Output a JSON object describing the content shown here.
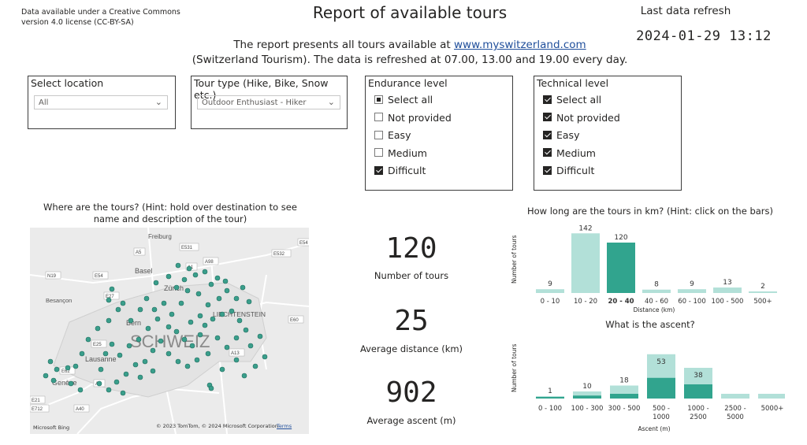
{
  "header": {
    "license": "Data available under a Creative Commons version 4.0 license (CC-BY-SA)",
    "title": "Report of available tours",
    "refresh_label": "Last data refresh",
    "refresh_value": "2024-01-29 13:12",
    "desc_pre": "The report presents all tours available at ",
    "desc_link": "www.myswitzerland.com",
    "desc_post": "(Switzerland Tourism). The data is refreshed at 07.00, 13.00 and 19.00 every day."
  },
  "filters": {
    "location": {
      "title": "Select location",
      "value": "All"
    },
    "tour_type": {
      "title": "Tour type (Hike, Bike, Snow etc.)",
      "value": "Outdoor Enthusiast - Hiker"
    },
    "endurance": {
      "title": "Endurance level",
      "items": [
        {
          "label": "Select all",
          "state": "partial"
        },
        {
          "label": "Not provided",
          "state": "off"
        },
        {
          "label": "Easy",
          "state": "off"
        },
        {
          "label": "Medium",
          "state": "off"
        },
        {
          "label": "Difficult",
          "state": "on"
        }
      ]
    },
    "technical": {
      "title": "Technical level",
      "items": [
        {
          "label": "Select all",
          "state": "on"
        },
        {
          "label": "Not provided",
          "state": "on"
        },
        {
          "label": "Easy",
          "state": "on"
        },
        {
          "label": "Medium",
          "state": "on"
        },
        {
          "label": "Difficult",
          "state": "on"
        }
      ]
    }
  },
  "map": {
    "title": "Where are the tours? (Hint: hold over destination to see name and description of the tour)",
    "labels": {
      "freiburg": "Freiburg",
      "basel": "Basel",
      "zurich": "Zürich",
      "bern": "Bern",
      "besancon": "Besançon",
      "lausanne": "Lausanne",
      "geneve": "Genève",
      "liechtenstein": "LIECHTENSTEIN",
      "country": "SCHWEIZ"
    },
    "roads": [
      "A5",
      "E531",
      "A98",
      "E54",
      "E532",
      "N19",
      "E54",
      "E27",
      "A1",
      "E60",
      "E25",
      "A13",
      "E62",
      "A9",
      "E21",
      "E712",
      "A40"
    ],
    "copyright": "© 2023 TomTom, © 2024 Microsoft Corporation",
    "terms": "Terms",
    "bing": "Microsoft Bing",
    "accent": "#3a9e8b"
  },
  "kpis": [
    {
      "value": "120",
      "label": "Number of tours"
    },
    {
      "value": "25",
      "label": "Average distance (km)"
    },
    {
      "value": "902",
      "label": "Average ascent (m)"
    }
  ],
  "chart_data": [
    {
      "type": "bar",
      "title": "How long are the tours in km? (Hint: click on the bars)",
      "xlabel": "Distance (km)",
      "ylabel": "Number of tours",
      "categories": [
        "0 - 10",
        "10 - 20",
        "20 - 40",
        "40 - 60",
        "60 - 100",
        "100 - 500",
        "500+"
      ],
      "values": [
        9,
        142,
        120,
        8,
        9,
        13,
        2
      ],
      "selected_index": 2,
      "colors": {
        "base": "#b2e0d8",
        "selected": "#31a48e"
      }
    },
    {
      "type": "bar",
      "title": "What is the ascent?",
      "xlabel": "Ascent (m)",
      "ylabel": "Number of tours",
      "categories": [
        "0 - 100",
        "100 - 300",
        "300 - 500",
        "500 - 1000",
        "1000 - 2500",
        "2500 - 5000",
        "5000+"
      ],
      "series": [
        {
          "values": [
            1,
            10,
            18,
            53,
            38,
            0,
            0
          ],
          "color": "#b2e0d8"
        },
        {
          "values": [
            1,
            5,
            8,
            35,
            24,
            0,
            0
          ],
          "color": "#31a48e"
        }
      ],
      "series_values_shown": [
        "1",
        "10",
        "18",
        "53",
        "38",
        "",
        ""
      ],
      "background_values": [
        2,
        12,
        22,
        75,
        52,
        8,
        8
      ]
    }
  ]
}
